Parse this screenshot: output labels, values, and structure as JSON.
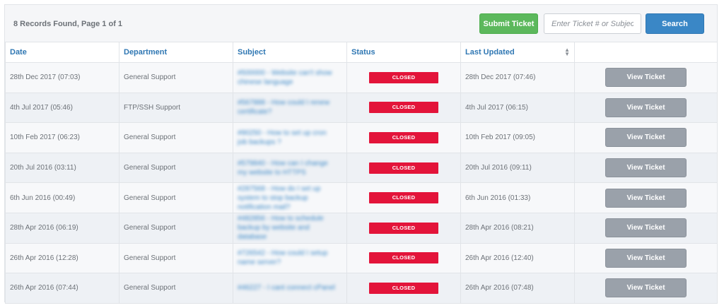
{
  "toolbar": {
    "records_info": "8 Records Found, Page 1 of 1",
    "submit_label": "Submit Ticket",
    "search_placeholder": "Enter Ticket # or Subject",
    "search_label": "Search"
  },
  "table": {
    "headers": {
      "date": "Date",
      "department": "Department",
      "subject": "Subject",
      "status": "Status",
      "last_updated": "Last Updated"
    },
    "rows": [
      {
        "date": "28th Dec 2017 (07:03)",
        "department": "General Support",
        "subject": "#500000 - Website can't show chinese language",
        "status": "CLOSED",
        "last_updated": "28th Dec 2017 (07:46)",
        "action": "View Ticket"
      },
      {
        "date": "4th Jul 2017 (05:46)",
        "department": "FTP/SSH Support",
        "subject": "#567888 - How could I renew certificate?",
        "status": "CLOSED",
        "last_updated": "4th Jul 2017 (06:15)",
        "action": "View Ticket"
      },
      {
        "date": "10th Feb 2017 (06:23)",
        "department": "General Support",
        "subject": "#90250 - How to set up cron job backups ?",
        "status": "CLOSED",
        "last_updated": "10th Feb 2017 (09:05)",
        "action": "View Ticket"
      },
      {
        "date": "20th Jul 2016 (03:11)",
        "department": "General Support",
        "subject": "#579840 - How can I change my website to HTTPS",
        "status": "CLOSED",
        "last_updated": "20th Jul 2016 (09:11)",
        "action": "View Ticket"
      },
      {
        "date": "6th Jun 2016 (00:49)",
        "department": "General Support",
        "subject": "#287568 - How do I set up system to stop backup notification mail?",
        "status": "CLOSED",
        "last_updated": "6th Jun 2016 (01:33)",
        "action": "View Ticket"
      },
      {
        "date": "28th Apr 2016 (06:19)",
        "department": "General Support",
        "subject": "#482856 - How to schedule backup by website and database",
        "status": "CLOSED",
        "last_updated": "28th Apr 2016 (08:21)",
        "action": "View Ticket"
      },
      {
        "date": "26th Apr 2016 (12:28)",
        "department": "General Support",
        "subject": "#726542 - How could I setup name server?",
        "status": "CLOSED",
        "last_updated": "26th Apr 2016 (12:40)",
        "action": "View Ticket"
      },
      {
        "date": "26th Apr 2016 (07:44)",
        "department": "General Support",
        "subject": "#46227 - I cant connect cPanel",
        "status": "CLOSED",
        "last_updated": "26th Apr 2016 (07:48)",
        "action": "View Ticket"
      }
    ]
  },
  "colors": {
    "accent": "#3a87c6",
    "submit_green": "#5cb85c",
    "status_closed": "#e3143a",
    "view_button": "#9aa1aa"
  }
}
